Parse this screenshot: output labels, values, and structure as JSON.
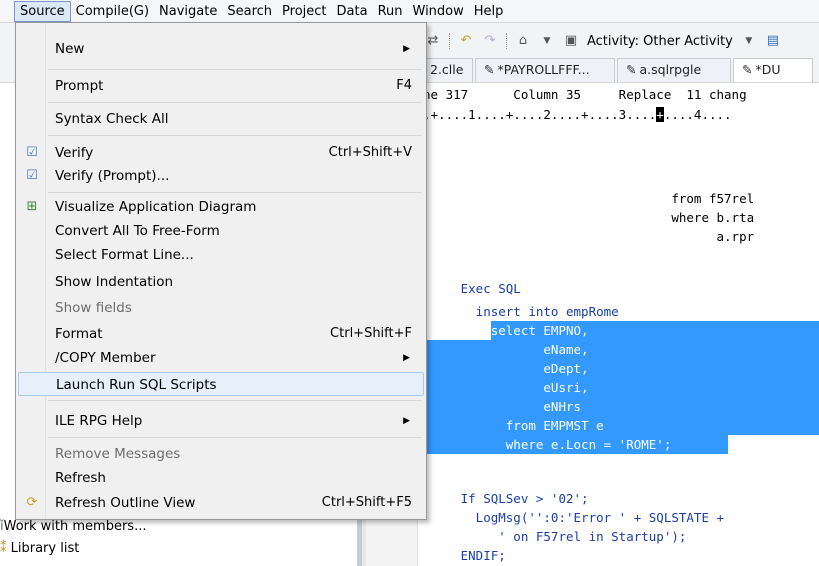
{
  "menubar": {
    "items": [
      "Source",
      "Compile(G)",
      "Navigate",
      "Search",
      "Project",
      "Data",
      "Run",
      "Window",
      "Help"
    ],
    "active_index": 0
  },
  "toolbar": {
    "activity_label": "Activity: Other Activity"
  },
  "editor_tabs": [
    {
      "label": "2.clle",
      "modified": false,
      "active": false
    },
    {
      "label": "*PAYROLLFFF...",
      "modified": true,
      "active": false
    },
    {
      "label": "a.sqlrpgle",
      "modified": false,
      "active": false
    },
    {
      "label": "*DU",
      "modified": true,
      "active": true
    }
  ],
  "editor": {
    "status_line": "ne 317      Column 35     Replace  11 chang",
    "ruler_before": ".+....1....+....2....+....3....",
    "ruler_cursor": "+",
    "ruler_after": "....4....",
    "lines": [
      {
        "text": "                                 from f57rel"
      },
      {
        "text": "                                 where b.rta"
      },
      {
        "text": "                                       a.rpr"
      },
      {
        "text": ""
      },
      {
        "text": "     Exec SQL"
      },
      {
        "text": "       insert into empRome"
      },
      {
        "text": "         select EMPNO,"
      },
      {
        "text": "                eName,"
      },
      {
        "text": "                eDept,"
      },
      {
        "text": "                eUsri,"
      },
      {
        "text": "                eNHrs"
      },
      {
        "text": "           from EMPMST e"
      },
      {
        "text": "           where e.Locn = 'ROME';"
      },
      {
        "text": ""
      },
      {
        "text": "     If SQLSev > '02';"
      },
      {
        "text": "       LogMsg('':0:'Error ' + SQLSTATE +"
      },
      {
        "text": "          ' on F57rel in Startup');"
      },
      {
        "text": "     ENDIF;"
      }
    ]
  },
  "left_panel": {
    "items": [
      "Work with members...",
      "Library list"
    ]
  },
  "source_menu": {
    "items": [
      {
        "label": "New",
        "accel": "",
        "submenu": true,
        "icon": "",
        "disabled": false
      },
      {
        "label": "Prompt",
        "accel": "F4",
        "submenu": false,
        "icon": "",
        "disabled": false
      },
      {
        "label": "Syntax Check All",
        "accel": "",
        "submenu": false,
        "icon": "",
        "disabled": false
      },
      {
        "label": "Verify",
        "accel": "Ctrl+Shift+V",
        "submenu": false,
        "icon": "verify-icon",
        "disabled": false
      },
      {
        "label": "Verify (Prompt)...",
        "accel": "",
        "submenu": false,
        "icon": "verify-prompt-icon",
        "disabled": false
      },
      {
        "label": "Visualize Application Diagram",
        "accel": "",
        "submenu": false,
        "icon": "diagram-icon",
        "disabled": false
      },
      {
        "label": "Convert All To Free-Form",
        "accel": "",
        "submenu": false,
        "icon": "",
        "disabled": false
      },
      {
        "label": "Select Format Line...",
        "accel": "",
        "submenu": false,
        "icon": "",
        "disabled": false
      },
      {
        "label": "Show Indentation",
        "accel": "",
        "submenu": false,
        "icon": "",
        "disabled": false
      },
      {
        "label": "Show fields",
        "accel": "",
        "submenu": false,
        "icon": "",
        "disabled": true
      },
      {
        "label": "Format",
        "accel": "Ctrl+Shift+F",
        "submenu": false,
        "icon": "",
        "disabled": false
      },
      {
        "label": "/COPY Member",
        "accel": "",
        "submenu": true,
        "icon": "",
        "disabled": false
      },
      {
        "label": "Launch Run SQL Scripts",
        "accel": "",
        "submenu": false,
        "icon": "",
        "disabled": false,
        "hover": true
      },
      {
        "label": "ILE RPG Help",
        "accel": "",
        "submenu": true,
        "icon": "",
        "disabled": false
      },
      {
        "label": "Remove Messages",
        "accel": "",
        "submenu": false,
        "icon": "",
        "disabled": true
      },
      {
        "label": "Refresh",
        "accel": "",
        "submenu": false,
        "icon": "",
        "disabled": false
      },
      {
        "label": "Refresh Outline View",
        "accel": "Ctrl+Shift+F5",
        "submenu": false,
        "icon": "refresh-outline-icon",
        "disabled": false
      }
    ]
  }
}
